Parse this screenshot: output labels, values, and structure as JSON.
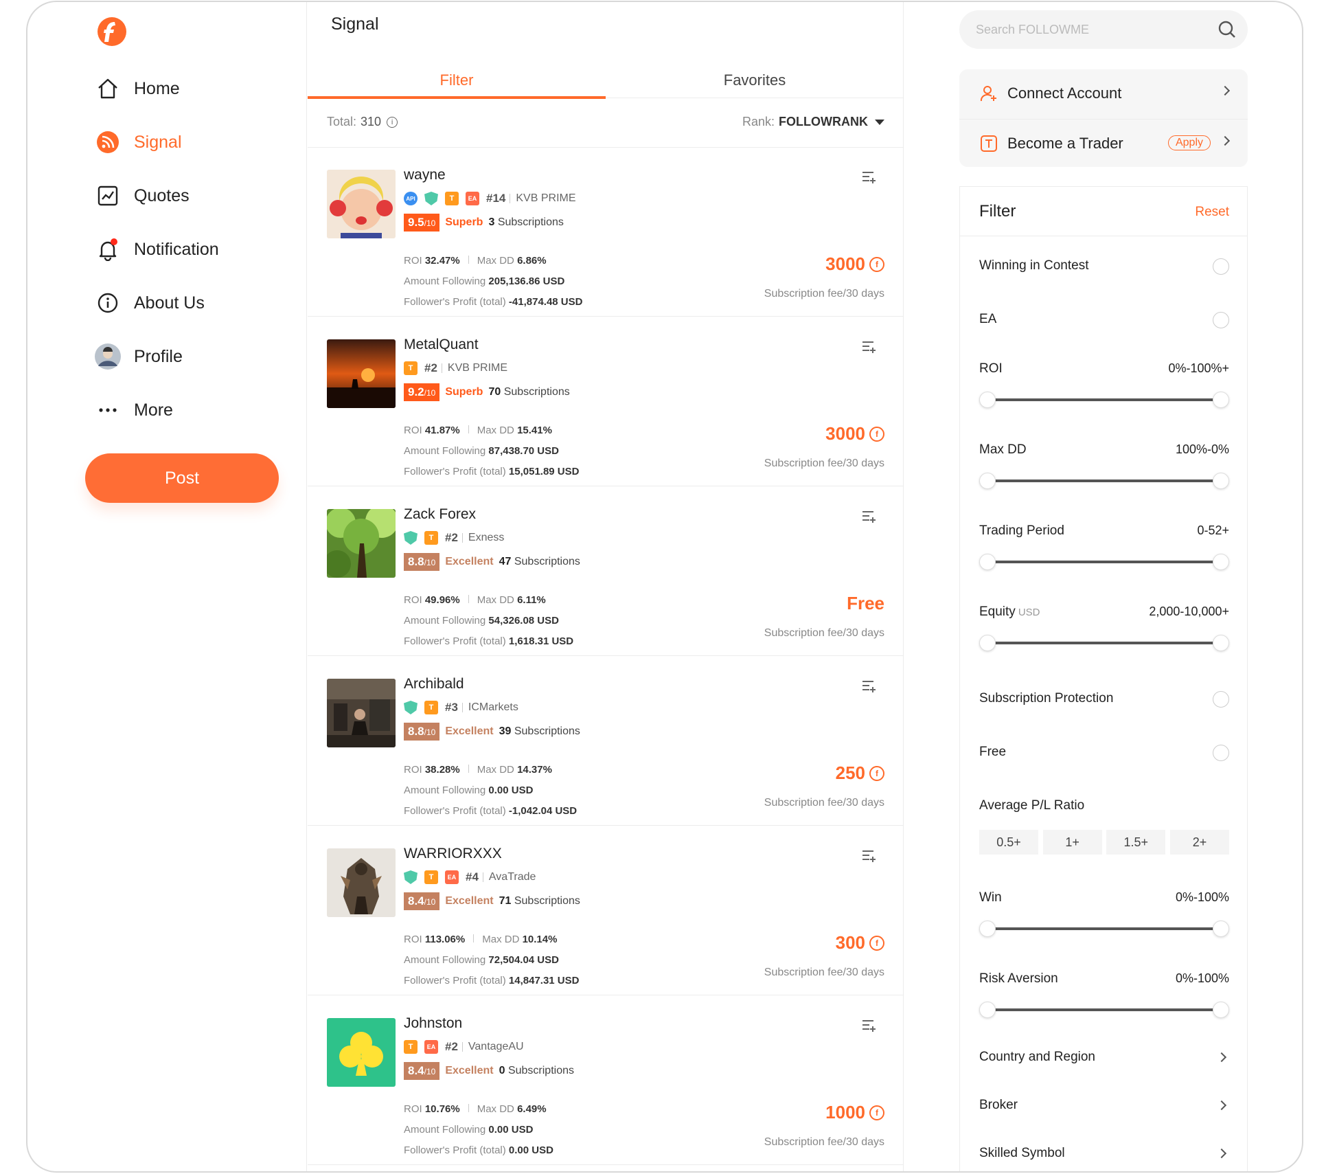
{
  "nav": {
    "items": [
      {
        "label": "Home"
      },
      {
        "label": "Signal"
      },
      {
        "label": "Quotes"
      },
      {
        "label": "Notification"
      },
      {
        "label": "About Us"
      },
      {
        "label": "Profile"
      },
      {
        "label": "More"
      }
    ],
    "post_label": "Post",
    "accent": "#ff6a2a"
  },
  "center": {
    "title": "Signal",
    "tabs": [
      {
        "label": "Filter"
      },
      {
        "label": "Favorites"
      }
    ],
    "total_label": "Total:",
    "total_value": "310",
    "rank_label": "Rank:",
    "rank_value": "FOLLOWRANK",
    "cards": [
      {
        "name": "wayne",
        "rank": "#14",
        "broker": "KVB PRIME",
        "score": "9.5",
        "score_den": "/10",
        "grade": "Superb",
        "subs_count": "3",
        "subs_label": "Subscriptions",
        "roi_label": "ROI",
        "roi": "32.47%",
        "dd_label": "Max DD",
        "dd": "6.86%",
        "follow_label": "Amount Following",
        "follow": "205,136.86 USD",
        "profit_label": "Follower's Profit (total)",
        "profit": "-41,874.48 USD",
        "fee": "3000",
        "fee_label": "Subscription fee/30 days"
      },
      {
        "name": "MetalQuant",
        "rank": "#2",
        "broker": "KVB PRIME",
        "score": "9.2",
        "score_den": "/10",
        "grade": "Superb",
        "subs_count": "70",
        "subs_label": "Subscriptions",
        "roi_label": "ROI",
        "roi": "41.87%",
        "dd_label": "Max DD",
        "dd": "15.41%",
        "follow_label": "Amount Following",
        "follow": "87,438.70 USD",
        "profit_label": "Follower's Profit (total)",
        "profit": "15,051.89 USD",
        "fee": "3000",
        "fee_label": "Subscription fee/30 days"
      },
      {
        "name": "Zack Forex",
        "rank": "#2",
        "broker": "Exness",
        "score": "8.8",
        "score_den": "/10",
        "grade": "Excellent",
        "subs_count": "47",
        "subs_label": "Subscriptions",
        "roi_label": "ROI",
        "roi": "49.96%",
        "dd_label": "Max DD",
        "dd": "6.11%",
        "follow_label": "Amount Following",
        "follow": "54,326.08 USD",
        "profit_label": "Follower's Profit (total)",
        "profit": "1,618.31 USD",
        "fee": "Free",
        "fee_label": "Subscription fee/30 days"
      },
      {
        "name": "Archibald",
        "rank": "#3",
        "broker": "ICMarkets",
        "score": "8.8",
        "score_den": "/10",
        "grade": "Excellent",
        "subs_count": "39",
        "subs_label": "Subscriptions",
        "roi_label": "ROI",
        "roi": "38.28%",
        "dd_label": "Max DD",
        "dd": "14.37%",
        "follow_label": "Amount Following",
        "follow": "0.00 USD",
        "profit_label": "Follower's Profit (total)",
        "profit": "-1,042.04 USD",
        "fee": "250",
        "fee_label": "Subscription fee/30 days"
      },
      {
        "name": "WARRIORXXX",
        "rank": "#4",
        "broker": "AvaTrade",
        "score": "8.4",
        "score_den": "/10",
        "grade": "Excellent",
        "subs_count": "71",
        "subs_label": "Subscriptions",
        "roi_label": "ROI",
        "roi": "113.06%",
        "dd_label": "Max DD",
        "dd": "10.14%",
        "follow_label": "Amount Following",
        "follow": "72,504.04 USD",
        "profit_label": "Follower's Profit (total)",
        "profit": "14,847.31 USD",
        "fee": "300",
        "fee_label": "Subscription fee/30 days"
      },
      {
        "name": "Johnston",
        "rank": "#2",
        "broker": "VantageAU",
        "score": "8.4",
        "score_den": "/10",
        "grade": "Excellent",
        "subs_count": "0",
        "subs_label": "Subscriptions",
        "roi_label": "ROI",
        "roi": "10.76%",
        "dd_label": "Max DD",
        "dd": "6.49%",
        "follow_label": "Amount Following",
        "follow": "0.00 USD",
        "profit_label": "Follower's Profit (total)",
        "profit": "0.00 USD",
        "fee": "1000",
        "fee_label": "Subscription fee/30 days"
      }
    ],
    "badge_text": {
      "t": "T",
      "ea": "EA",
      "api": "API"
    }
  },
  "right": {
    "search_placeholder": "Search FOLLOWME",
    "connect_label": "Connect Account",
    "trader_label": "Become a Trader",
    "apply_label": "Apply",
    "filter_title": "Filter",
    "reset_label": "Reset",
    "winning": "Winning in Contest",
    "ea": "EA",
    "roi": {
      "label": "ROI",
      "range": "0%-100%+",
      "low": 0,
      "high": 1.0
    },
    "maxdd": {
      "label": "Max DD",
      "range": "100%-0%",
      "low": 0,
      "high": 1.0
    },
    "period": {
      "label": "Trading Period",
      "range": "0-52+",
      "low": 0,
      "high": 1.0
    },
    "equity": {
      "label": "Equity",
      "unit": "USD",
      "range": "2,000-10,000+",
      "low": 0,
      "high": 1.0
    },
    "sub_protect": "Subscription Protection",
    "free": "Free",
    "plratio_label": "Average P/L Ratio",
    "plratio_options": [
      "0.5+",
      "1+",
      "1.5+",
      "2+"
    ],
    "win": {
      "label": "Win",
      "range": "0%-100%",
      "low": 0,
      "high": 1.0
    },
    "risk": {
      "label": "Risk Aversion",
      "range": "0%-100%",
      "low": 0,
      "high": 1.0
    },
    "country": "Country and Region",
    "broker": "Broker",
    "symbol": "Skilled Symbol"
  }
}
